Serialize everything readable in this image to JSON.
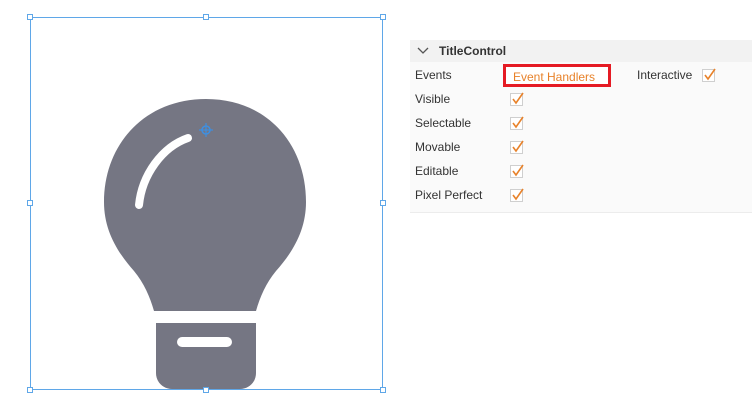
{
  "canvas": {
    "selected_object": "lightbulb",
    "pivot_icon": "crosshair-icon"
  },
  "panel": {
    "section_title": "TitleControl",
    "collapse_icon": "chevron-down-icon",
    "events_label": "Events",
    "events_button_label": "Event Handlers",
    "interactive_label": "Interactive",
    "interactive_checked": true,
    "rows": [
      {
        "label": "Visible",
        "checked": true
      },
      {
        "label": "Selectable",
        "checked": true
      },
      {
        "label": "Movable",
        "checked": true
      },
      {
        "label": "Editable",
        "checked": true
      },
      {
        "label": "Pixel Perfect",
        "checked": true
      }
    ]
  },
  "colors": {
    "accent": "#e8822a",
    "highlight_border": "#e51b24",
    "selection": "#5fa7e8",
    "bulb": "#757683"
  }
}
